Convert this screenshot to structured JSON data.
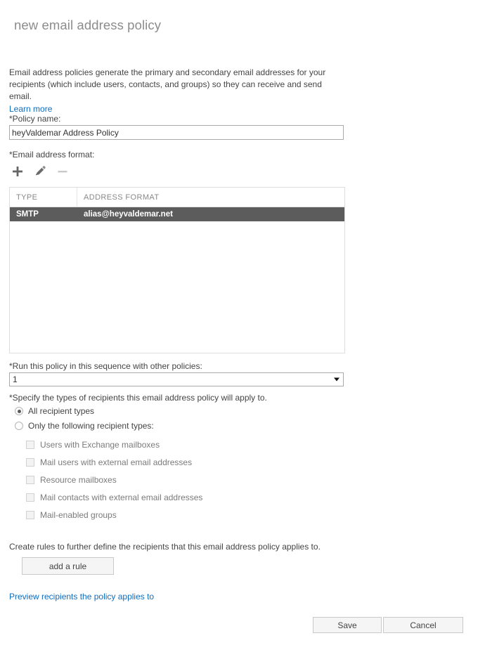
{
  "header": {
    "title": "new email address policy"
  },
  "intro": {
    "text": "Email address policies generate the primary and secondary email addresses for your recipients (which include users, contacts, and groups) so they can receive and send email.",
    "learn_more": "Learn more"
  },
  "policy_name": {
    "label": "*Policy name:",
    "value": "heyValdemar Address Policy",
    "placeholder": ""
  },
  "email_format": {
    "label": "*Email address format:",
    "toolbar": [
      {
        "name": "add-icon",
        "glyph": "+",
        "enabled": true
      },
      {
        "name": "edit-pencil-icon",
        "glyph": "pencil",
        "enabled": true
      },
      {
        "name": "remove-icon",
        "glyph": "−",
        "enabled": false
      }
    ],
    "columns": [
      "TYPE",
      "ADDRESS FORMAT"
    ],
    "rows": [
      {
        "type": "SMTP",
        "format": "alias@heyvaldemar.net",
        "selected": true
      }
    ]
  },
  "sequence": {
    "label": "*Run this policy in this sequence with other policies:",
    "value": "1",
    "options": [
      "1"
    ]
  },
  "recipient_types": {
    "label": "*Specify the types of recipients this email address policy will apply to.",
    "radios": [
      {
        "label": "All recipient types",
        "checked": true
      },
      {
        "label": "Only the following recipient types:",
        "checked": false
      }
    ],
    "checkboxes": [
      {
        "label": "Users with Exchange mailboxes",
        "checked": false
      },
      {
        "label": "Mail users with external email addresses",
        "checked": false
      },
      {
        "label": "Resource mailboxes",
        "checked": false
      },
      {
        "label": "Mail contacts with external email addresses",
        "checked": false
      },
      {
        "label": "Mail-enabled groups",
        "checked": false
      }
    ]
  },
  "rules": {
    "description": "Create rules to further define the recipients that this email address policy applies to.",
    "add_rule_label": "add a rule",
    "preview_link": "Preview recipients the policy applies to"
  },
  "footer": {
    "save_label": "Save",
    "cancel_label": "Cancel"
  },
  "colors": {
    "link": "#0f6cbd",
    "selected_row_bg": "#5c5c5c",
    "title": "#8c8c8c"
  }
}
